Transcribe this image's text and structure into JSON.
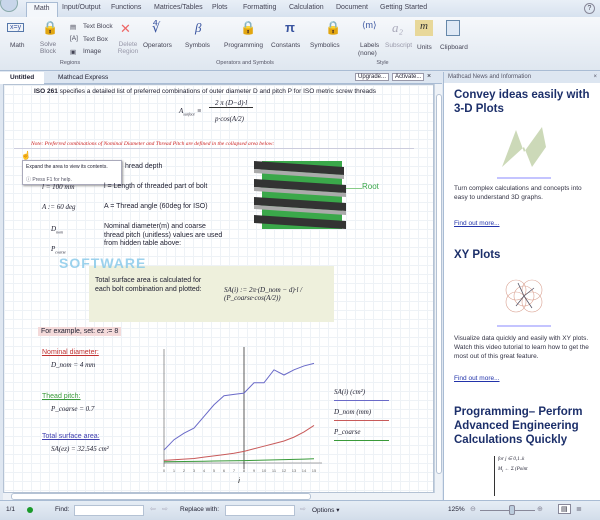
{
  "ribbon": {
    "tabs": [
      "Math",
      "Input/Output",
      "Functions",
      "Matrices/Tables",
      "Plots",
      "Formatting",
      "Calculation",
      "Document",
      "Getting Started"
    ],
    "active_tab": "Math",
    "help": "?",
    "buttons": {
      "math": "Math",
      "solve_block": "Solve Block",
      "text_block": "Text Block",
      "text_box": "Text Box",
      "image": "Image",
      "delete_region": "Delete Region",
      "operators": "Operators",
      "symbols": "Symbols",
      "programming": "Programming",
      "constants": "Constants",
      "symbolics": "Symbolics",
      "labels": "Labels",
      "labels_value": "(none)",
      "subscript": "Subscript",
      "units": "Units",
      "clipboard": "Clipboard"
    },
    "groups": {
      "regions": "Regions",
      "operators_symbols": "Operators and Symbols",
      "style": "Style"
    }
  },
  "doc_tabs": {
    "tabs": [
      "Untitled",
      "Mathcad Express"
    ],
    "upgrade": "Upgrade...",
    "activate": "Activate..."
  },
  "worksheet": {
    "intro_bold": "ISO 261",
    "intro": "specifies a detailed list of preferred combinations of outer diameter D and pitch P for ISO metric screw threads",
    "formula_lhs": "A",
    "formula_sub": "surface",
    "formula_num": "2 π (D−d)·l",
    "formula_den": "p·cos(A/2)",
    "note": "Note: Preferred combinations of Nominal Diameter and Thread Pitch are defined in the collapsed area below:",
    "tooltip": {
      "line1": "Expand the area to view its contents.",
      "line2": "Press F1 for help."
    },
    "thread_depth": "hread depth",
    "l_def": "l = 100 mm",
    "l_desc": "l = Length of threaded part of bolt",
    "A_def": "A := 60 deg",
    "A_desc": "A = Thread angle (60deg for ISO)",
    "D_nom": "D",
    "P_nom": "P",
    "nominal_desc": "Nominal diameter(m) and coarse thread pitch (unitless) values are used from hidden table above:",
    "image_label": "Root",
    "sa_desc": "Total surface area is calculated for each bolt combination and plotted:",
    "sa_formula": "SA(i) := 2π·(D_nom − d)·l / (P_coarse·cos(A/2))",
    "example": "For example, set:   ez := 8",
    "nominal_diameter_label": "Nominal diameter:",
    "nominal_diameter_value": "D_nom = 4 mm",
    "thread_pitch_label": "Thead pitch:",
    "thread_pitch_value": "P_coarse = 0.7",
    "total_area_label": "Total surface area:",
    "total_area_value": "SA(ez) = 32.545 cm²",
    "plot": {
      "x": [
        0,
        1,
        2,
        3,
        4,
        5,
        6,
        7,
        8,
        9,
        10,
        11,
        12,
        13,
        14,
        15
      ],
      "xlabel": "i",
      "cursor_x": 8,
      "series": [
        {
          "name": "SA(i) (cm²)",
          "color": "#6a6ac8",
          "values": [
            10,
            18,
            23,
            27,
            36,
            45,
            52,
            53,
            54,
            62,
            62,
            72,
            68,
            72,
            75,
            77
          ]
        },
        {
          "name": "D_nom (mm)",
          "color": "#c85a5a",
          "values": [
            2,
            2.5,
            3,
            3.5,
            4.5,
            5.5,
            6.5,
            7.5,
            9,
            11,
            13,
            15,
            17,
            20,
            24,
            29
          ]
        },
        {
          "name": "P_coarse",
          "color": "#3a9a3a",
          "values": [
            1,
            1.1,
            1.2,
            1.3,
            1.4,
            1.5,
            1.6,
            1.7,
            1.8,
            2,
            2.2,
            2.4,
            2.6,
            2.8,
            3,
            3.3
          ]
        }
      ]
    }
  },
  "panel": {
    "title": "Mathcad News and Information",
    "items": [
      {
        "heading": "Convey ideas easily with 3-D Plots",
        "text": "Turn complex calculations and concepts  into easy to understand 3D graphs.",
        "link": "Find out more..."
      },
      {
        "heading": "XY Plots",
        "text": "Visualize data quickly and easily with XY plots.  Watch this video tutorial to learn how to get the most out of this great feature.",
        "link": "Find out more..."
      },
      {
        "heading": "Programming– Perform Advanced Engineering Calculations Quickly"
      }
    ]
  },
  "status": {
    "page": "1/1",
    "find_label": "Find:",
    "replace_label": "Replace with:",
    "options": "Options",
    "zoom": "125%"
  }
}
